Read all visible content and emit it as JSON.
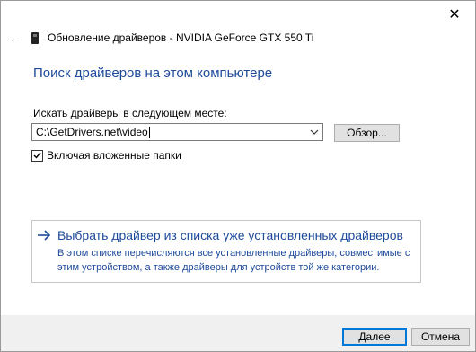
{
  "window": {
    "close_glyph": "✕",
    "back_glyph": "←",
    "title": "Обновление драйверов - NVIDIA GeForce GTX 550 Ti"
  },
  "main": {
    "heading": "Поиск драйверов на этом компьютере",
    "search_label": "Искать драйверы в следующем месте:",
    "path_value": "C:\\GetDrivers.net\\video",
    "browse_label": "Обзор...",
    "include_subfolders": {
      "label": "Включая вложенные папки",
      "checked": true
    },
    "pick_option": {
      "title": "Выбрать драйвер из списка уже установленных драйверов",
      "description": "В этом списке перечисляются все установленные драйверы, совместимые с этим устройством, а также драйверы для устройств той же категории."
    }
  },
  "footer": {
    "next_label": "Далее",
    "cancel_label": "Отмена"
  },
  "colors": {
    "accent": "#1e4a9a",
    "focus_border": "#0078d7",
    "footer_bg": "#f0f0f0"
  }
}
